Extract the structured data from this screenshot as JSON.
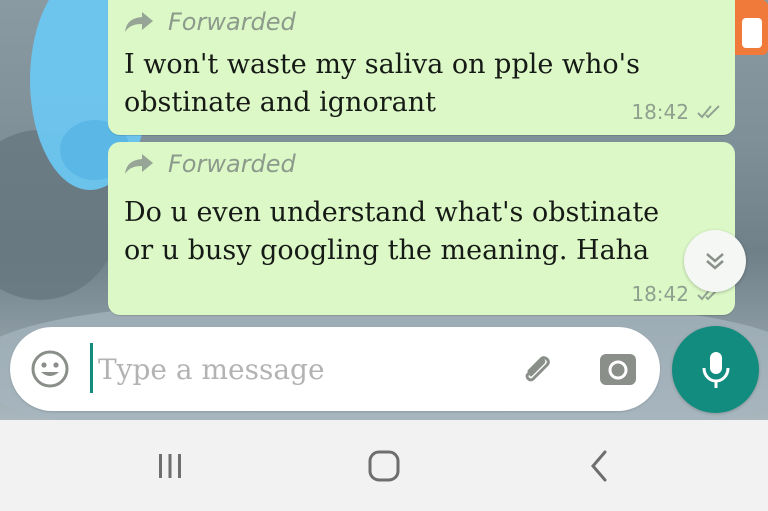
{
  "messages": [
    {
      "forwarded_label": "Forwarded",
      "text": "I won't waste my saliva on pple who's obstinate and ignorant",
      "time": "18:42",
      "status_icon": "double-check-icon"
    },
    {
      "forwarded_label": "Forwarded",
      "text": "Do u even understand what's obstinate or u busy googling the meaning. Haha",
      "time": "18:42",
      "status_icon": "double-check-icon"
    }
  ],
  "composer": {
    "placeholder": "Type a message",
    "value": ""
  },
  "icons": {
    "emoji": "smiley-icon",
    "attach": "paperclip-icon",
    "camera": "camera-icon",
    "mic": "microphone-icon",
    "scroll": "double-chevron-down-icon",
    "nav_recents": "recents-icon",
    "nav_home": "home-icon",
    "nav_back": "back-icon"
  },
  "colors": {
    "bubble_out": "#dcf8c6",
    "accent": "#128c7e",
    "meta_text": "#8fa08f"
  }
}
